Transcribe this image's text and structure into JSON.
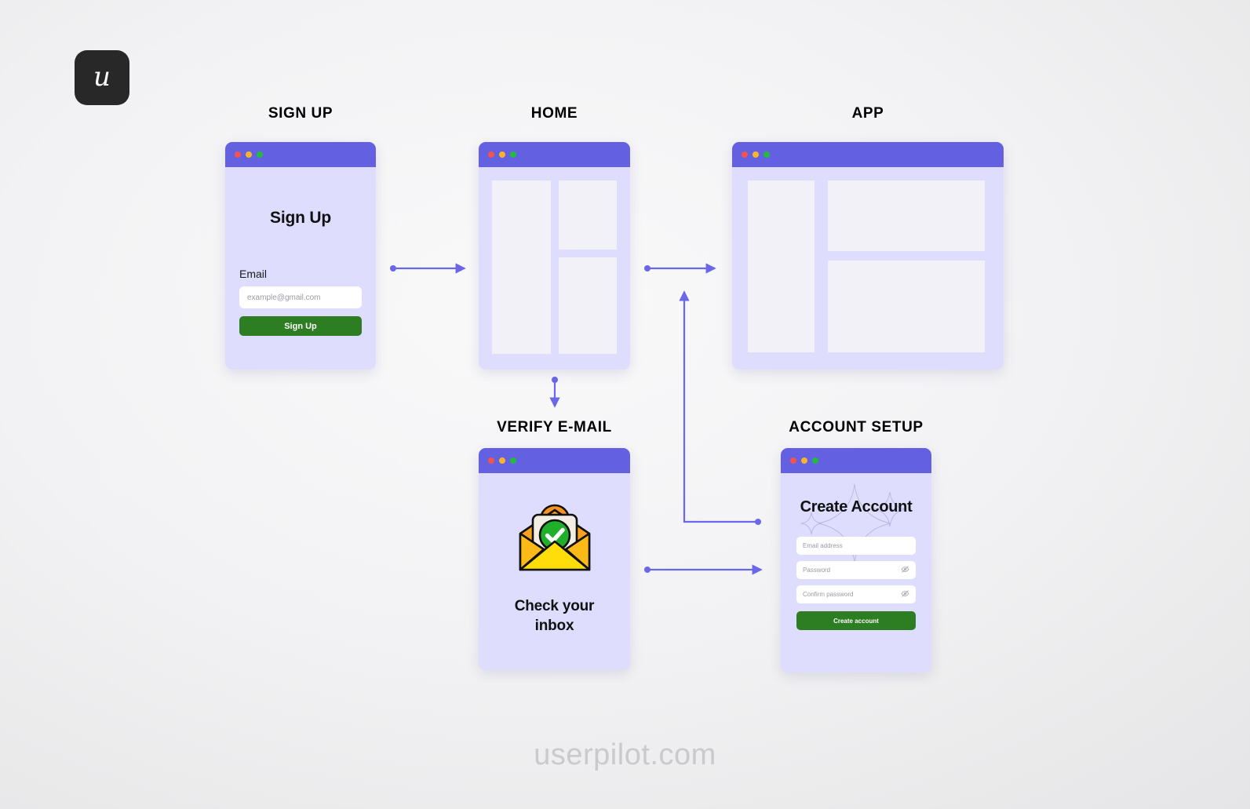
{
  "brand": {
    "logo_glyph": "u",
    "logo_icon": "userpilot-logo-icon",
    "watermark": "userpilot.com"
  },
  "colors": {
    "titlebar_purple": "#6360E2",
    "card_body_lavender": "#DEDDFD",
    "panel_grey": "#F2F1F8",
    "cta_green": "#2D7D22",
    "connector_blue": "#6A67E8",
    "dot_red": "#F4544C",
    "dot_yellow": "#F7B62A",
    "dot_green": "#24BA3C",
    "background": "#F2F2F4",
    "watermark_grey": "#C9C9CE"
  },
  "steps": [
    {
      "id": "signup",
      "caption": "SIGN UP",
      "heading": "Sign Up",
      "field_label": "Email",
      "email_placeholder": "example@gmail.com",
      "cta_label": "Sign Up"
    },
    {
      "id": "home",
      "caption": "HOME"
    },
    {
      "id": "app",
      "caption": "APP"
    },
    {
      "id": "verify",
      "caption": "VERIFY E-MAIL",
      "illustration": "envelope-with-check-icon",
      "message_line1": "Check your",
      "message_line2": "inbox"
    },
    {
      "id": "account",
      "caption": "ACCOUNT SETUP",
      "heading": "Create Account",
      "fields": [
        {
          "placeholder": "Email address",
          "type": "email",
          "has_reveal_icon": false
        },
        {
          "placeholder": "Password",
          "type": "password",
          "has_reveal_icon": true
        },
        {
          "placeholder": "Confirm password",
          "type": "password",
          "has_reveal_icon": true
        }
      ],
      "cta_label": "Create account"
    }
  ],
  "connectors": [
    {
      "id": "signup-to-home",
      "from": "signup",
      "to": "home",
      "shape": "horizontal"
    },
    {
      "id": "home-to-app",
      "from": "home",
      "to": "app",
      "shape": "horizontal"
    },
    {
      "id": "home-to-verify",
      "from": "home",
      "to": "verify",
      "shape": "vertical"
    },
    {
      "id": "verify-to-account",
      "from": "verify",
      "to": "account",
      "shape": "horizontal"
    },
    {
      "id": "account-to-app",
      "from": "account",
      "to": "app",
      "shape": "elbow"
    }
  ],
  "window_dots": [
    {
      "name": "close-dot",
      "color": "red"
    },
    {
      "name": "minimize-dot",
      "color": "yellow"
    },
    {
      "name": "maximize-dot",
      "color": "green"
    }
  ]
}
